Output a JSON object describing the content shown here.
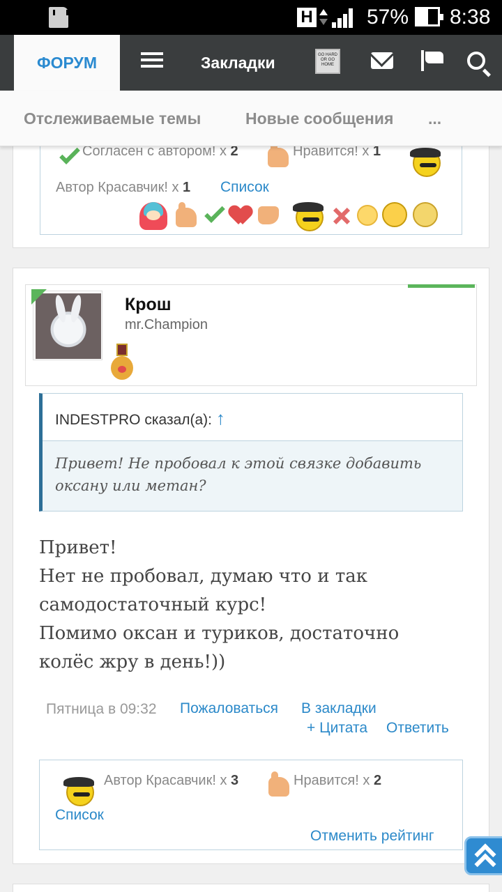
{
  "status_bar": {
    "battery_percent": "57%",
    "time": "8:38",
    "h_label": "H"
  },
  "top_nav": {
    "forum_tab": "ФОРУМ",
    "bookmarks": "Закладки",
    "avatar_text": "GO HARD OR GO HOME"
  },
  "sub_nav": {
    "watched_threads": "Отслеживаемые темы",
    "new_messages": "Новые сообщения",
    "more": "..."
  },
  "prev_post": {
    "ratings": [
      {
        "label": "Согласен с автором!",
        "sep": " x ",
        "count": "2"
      },
      {
        "label": "Нравится!",
        "sep": " x ",
        "count": "1"
      },
      {
        "label": "Автор Красавчик!",
        "sep": " x ",
        "count": "1"
      }
    ],
    "list_link": "Список"
  },
  "post": {
    "author_name": "Крош",
    "author_title": "mr.Champion",
    "quote_author": "INDESTPRO сказал(а):",
    "quote_arrow": "↑",
    "quote_lines": [
      "Привет! Не пробовал к этой связке добавить",
      "оксану или метан?"
    ],
    "message_lines": [
      "Привет!",
      "Нет не пробовал, думаю что и так",
      "самодостаточный курс!",
      "Помимо оксан и туриков, достаточно",
      "колёс жру в день!))"
    ],
    "date": "Пятница в 09:32",
    "actions": {
      "report": "Пожаловаться",
      "bookmark": "В закладки",
      "quote": "+ Цитата",
      "reply": "Ответить"
    },
    "ratings": [
      {
        "label": "Автор Красавчик!",
        "sep": " x ",
        "count": "3"
      },
      {
        "label": "Нравится!",
        "sep": " x ",
        "count": "2"
      }
    ],
    "list_link": "Список",
    "cancel_rating": "Отменить рейтинг"
  }
}
